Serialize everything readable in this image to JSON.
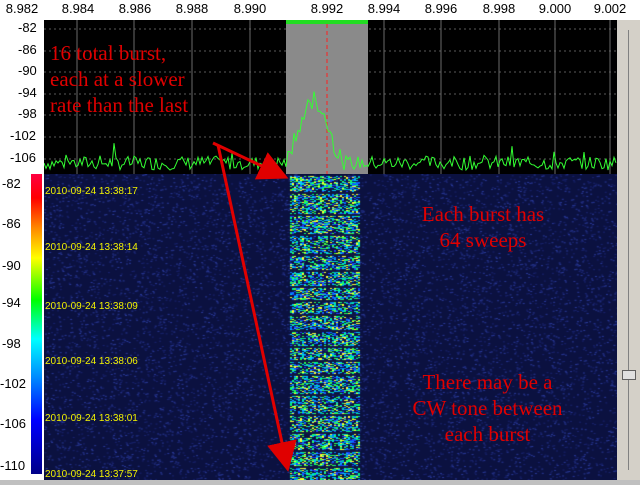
{
  "frequency_axis": {
    "labels": [
      "8.982",
      "8.984",
      "8.986",
      "8.988",
      "8.990",
      "8.992",
      "8.994",
      "8.996",
      "8.998",
      "9.000",
      "9.002"
    ]
  },
  "spectrum": {
    "db_labels": [
      "-82",
      "-86",
      "-90",
      "-94",
      "-98",
      "-102",
      "-106"
    ]
  },
  "waterfall": {
    "db_labels": [
      "-82",
      "-86",
      "-90",
      "-94",
      "-98",
      "-102",
      "-106",
      "-110"
    ],
    "timestamps": [
      "2010-09-24 13:38:17",
      "2010-09-24 13:38:14",
      "2010-09-24 13:38:09",
      "2010-09-24 13:38:06",
      "2010-09-24 13:38:01",
      "2010-09-24 13:37:57"
    ]
  },
  "annotations": {
    "top_left_line1": "16 total burst,",
    "top_left_line2": "each at a slower",
    "top_left_line3": "rate than the last",
    "right_1_line1": "Each burst has",
    "right_1_line2": "64 sweeps",
    "right_2_line1": "There may be a",
    "right_2_line2": "CW tone between",
    "right_2_line3": "each burst"
  },
  "colors": {
    "annotation": "#e00000",
    "selection": "#8a8a8a",
    "marker": "#ff2020",
    "trace": "#33ff33",
    "timestamp": "#f2f200"
  }
}
